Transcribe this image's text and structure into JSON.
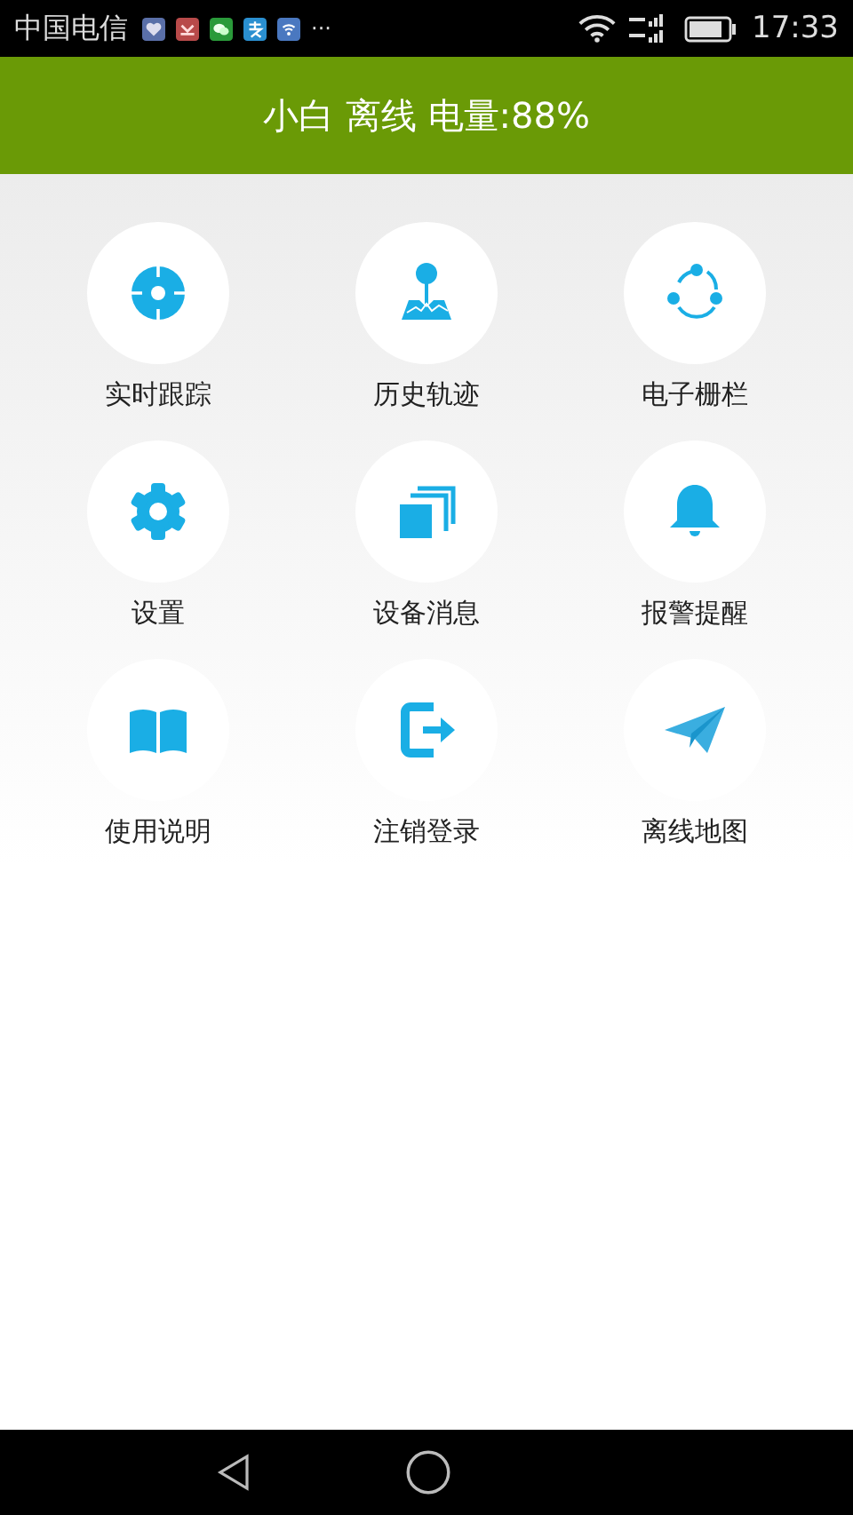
{
  "status_bar": {
    "carrier": "中国电信",
    "overflow": "···",
    "time": "17:33"
  },
  "header": {
    "title": "小白 离线 电量:88%"
  },
  "menu": [
    {
      "label": "实时跟踪"
    },
    {
      "label": "历史轨迹"
    },
    {
      "label": "电子栅栏"
    },
    {
      "label": "设置"
    },
    {
      "label": "设备消息"
    },
    {
      "label": "报警提醒"
    },
    {
      "label": "使用说明"
    },
    {
      "label": "注销登录"
    },
    {
      "label": "离线地图"
    }
  ]
}
